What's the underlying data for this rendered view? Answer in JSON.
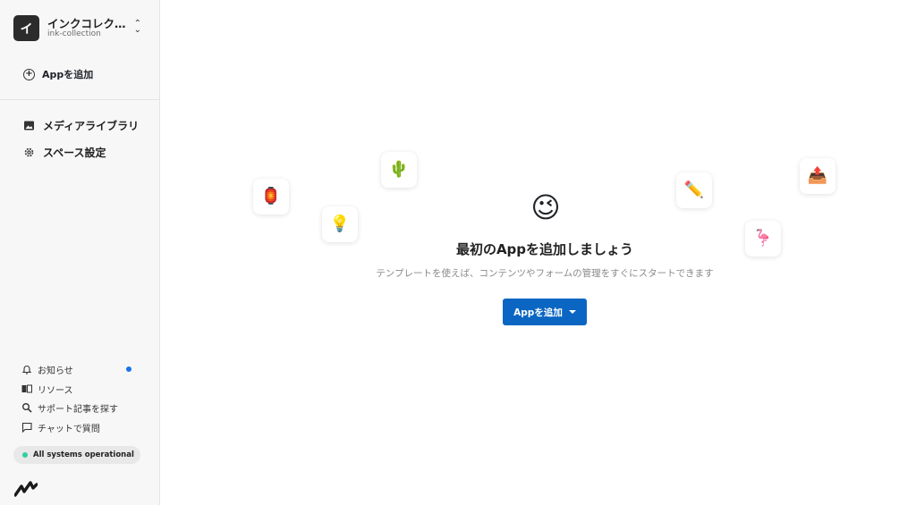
{
  "space": {
    "avatar_letter": "イ",
    "name": "インクコレクシ...",
    "id": "ink-collection"
  },
  "sidebar": {
    "add_app_label": "Appを追加",
    "nav": [
      {
        "label": "メディアライブラリ",
        "icon": "image-icon"
      },
      {
        "label": "スペース設定",
        "icon": "gear-icon"
      }
    ],
    "bottom": [
      {
        "label": "お知らせ",
        "icon": "bell-icon"
      },
      {
        "label": "リソース",
        "icon": "book-icon"
      },
      {
        "label": "サポート記事を探す",
        "icon": "search-icon"
      },
      {
        "label": "チャットで質問",
        "icon": "chat-icon"
      }
    ],
    "status": "All systems operational",
    "status_color": "#2ecfa0",
    "notif_color": "#1a73e8"
  },
  "main": {
    "hero_emoji": "😉",
    "title": "最初のAppを追加しましょう",
    "subtitle": "テンプレートを使えば、コンテンツやフォームの管理をすぐにスタートできます",
    "cta_label": "Appを追加",
    "cta_color": "#0a66c2",
    "floating_emojis": [
      "🏮",
      "💡",
      "🌵",
      "✏️",
      "🦩",
      "📤"
    ]
  }
}
